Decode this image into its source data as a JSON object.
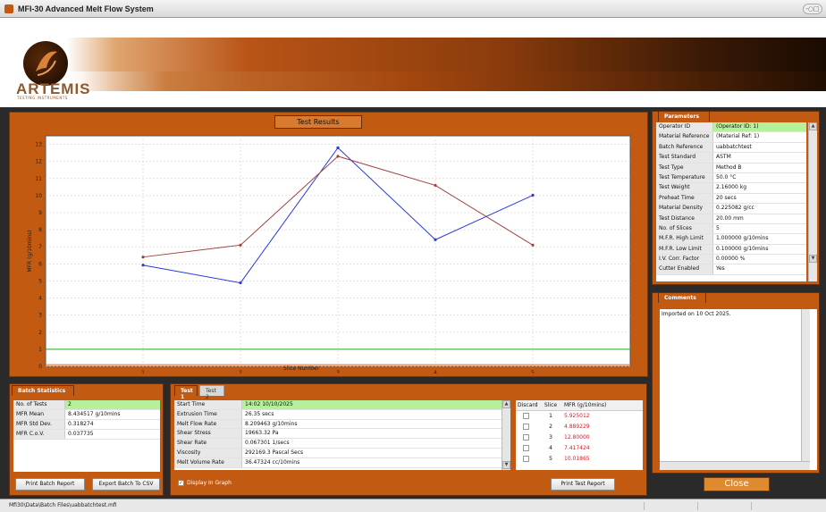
{
  "window": {
    "title": "MFI-30 Advanced Melt Flow System",
    "controls": "-○□"
  },
  "brand": {
    "name": "ARTEMIS",
    "tagline": "TESTING INSTRUMENTS"
  },
  "chart_panel": {
    "title": "Test Results"
  },
  "chart_data": {
    "type": "line",
    "xlabel": "Slice Number",
    "ylabel": "MFR (g/10mins)",
    "x": [
      1,
      2,
      3,
      4,
      5
    ],
    "xlim": [
      0,
      6
    ],
    "ylim": [
      0,
      13.5
    ],
    "yticks": [
      0,
      1,
      2,
      3,
      4,
      5,
      6,
      7,
      8,
      9,
      10,
      11,
      12,
      13
    ],
    "grid": true,
    "series": [
      {
        "values": [
          5.925012,
          4.889229,
          12.8,
          7.417424,
          10.01865
        ],
        "color": "#2a3adc"
      },
      {
        "values": [
          6.4,
          7.1,
          12.3,
          10.6,
          7.1
        ],
        "color": "#a04040"
      }
    ],
    "limit_lines": [
      {
        "value": 1.0,
        "color": "#22aa22"
      },
      {
        "value": 0.1,
        "color": "#e06a20"
      }
    ]
  },
  "parameters": {
    "tab": "Parameters",
    "rows": [
      {
        "key": "Operator ID",
        "value": "(Operator ID: 1)",
        "highlight": true
      },
      {
        "key": "Material Reference",
        "value": "(Material Ref: 1)"
      },
      {
        "key": "Batch Reference",
        "value": "uabbatchtest"
      },
      {
        "key": "Test Standard",
        "value": "ASTM"
      },
      {
        "key": "Test Type",
        "value": "Method B"
      },
      {
        "key": "Test Temperature",
        "value": "50.0 °C"
      },
      {
        "key": "Test Weight",
        "value": "2.16000 kg"
      },
      {
        "key": "Preheat Time",
        "value": "20 secs"
      },
      {
        "key": "Material Density",
        "value": "0.225082 g/cc"
      },
      {
        "key": "Test Distance",
        "value": "20.00 mm"
      },
      {
        "key": "No. of Slices",
        "value": "5"
      },
      {
        "key": "M.F.R. High Limit",
        "value": "1.000000 g/10mins"
      },
      {
        "key": "M.F.R. Low Limit",
        "value": "0.100000 g/10mins"
      },
      {
        "key": "I.V. Corr. Factor",
        "value": "0.00000 %"
      },
      {
        "key": "Cutter Enabled",
        "value": "Yes"
      }
    ]
  },
  "comments": {
    "tab": "Comments",
    "text": "Imported on 10 Oct 2025."
  },
  "close_label": "Close",
  "batch": {
    "tab": "Batch Statistics",
    "rows": [
      {
        "key": "No. of Tests",
        "value": "2",
        "highlight": true
      },
      {
        "key": "MFR Mean",
        "value": "8.434517 g/10mins"
      },
      {
        "key": "MFR Std Dev.",
        "value": "0.318274"
      },
      {
        "key": "MFR C.o.V.",
        "value": "0.037735"
      }
    ],
    "print_label": "Print Batch Report",
    "export_label": "Export Batch To CSV"
  },
  "test": {
    "tabs": [
      "Test 1",
      "Test 2"
    ],
    "rows": [
      {
        "key": "Start Time",
        "value": "14:02 10/10/2025",
        "highlight": true
      },
      {
        "key": "Extrusion Time",
        "value": "26.35 secs"
      },
      {
        "key": "Melt Flow Rate",
        "value": "8.209463 g/10mins"
      },
      {
        "key": "Shear Stress",
        "value": "19663.32 Pa"
      },
      {
        "key": "Shear Rate",
        "value": "0.067301 1/secs"
      },
      {
        "key": "Viscosity",
        "value": "292169.3 Pascal Secs"
      },
      {
        "key": "Melt Volume Rate",
        "value": "36.47324 cc/10mins"
      }
    ],
    "slices_header": {
      "discard": "Discard",
      "slice": "Slice",
      "mfr": "MFR (g/10mins)"
    },
    "slices": [
      {
        "slice": "1",
        "mfr": "5.925012"
      },
      {
        "slice": "2",
        "mfr": "4.889229"
      },
      {
        "slice": "3",
        "mfr": "12.80000"
      },
      {
        "slice": "4",
        "mfr": "7.417424"
      },
      {
        "slice": "5",
        "mfr": "10.01865"
      }
    ],
    "print_label": "Print Test Report",
    "checkbox_label": "Display In Graph"
  },
  "status": {
    "text": "Mfi30\\Data\\Batch Files\\uabbatchtest.mfi"
  }
}
